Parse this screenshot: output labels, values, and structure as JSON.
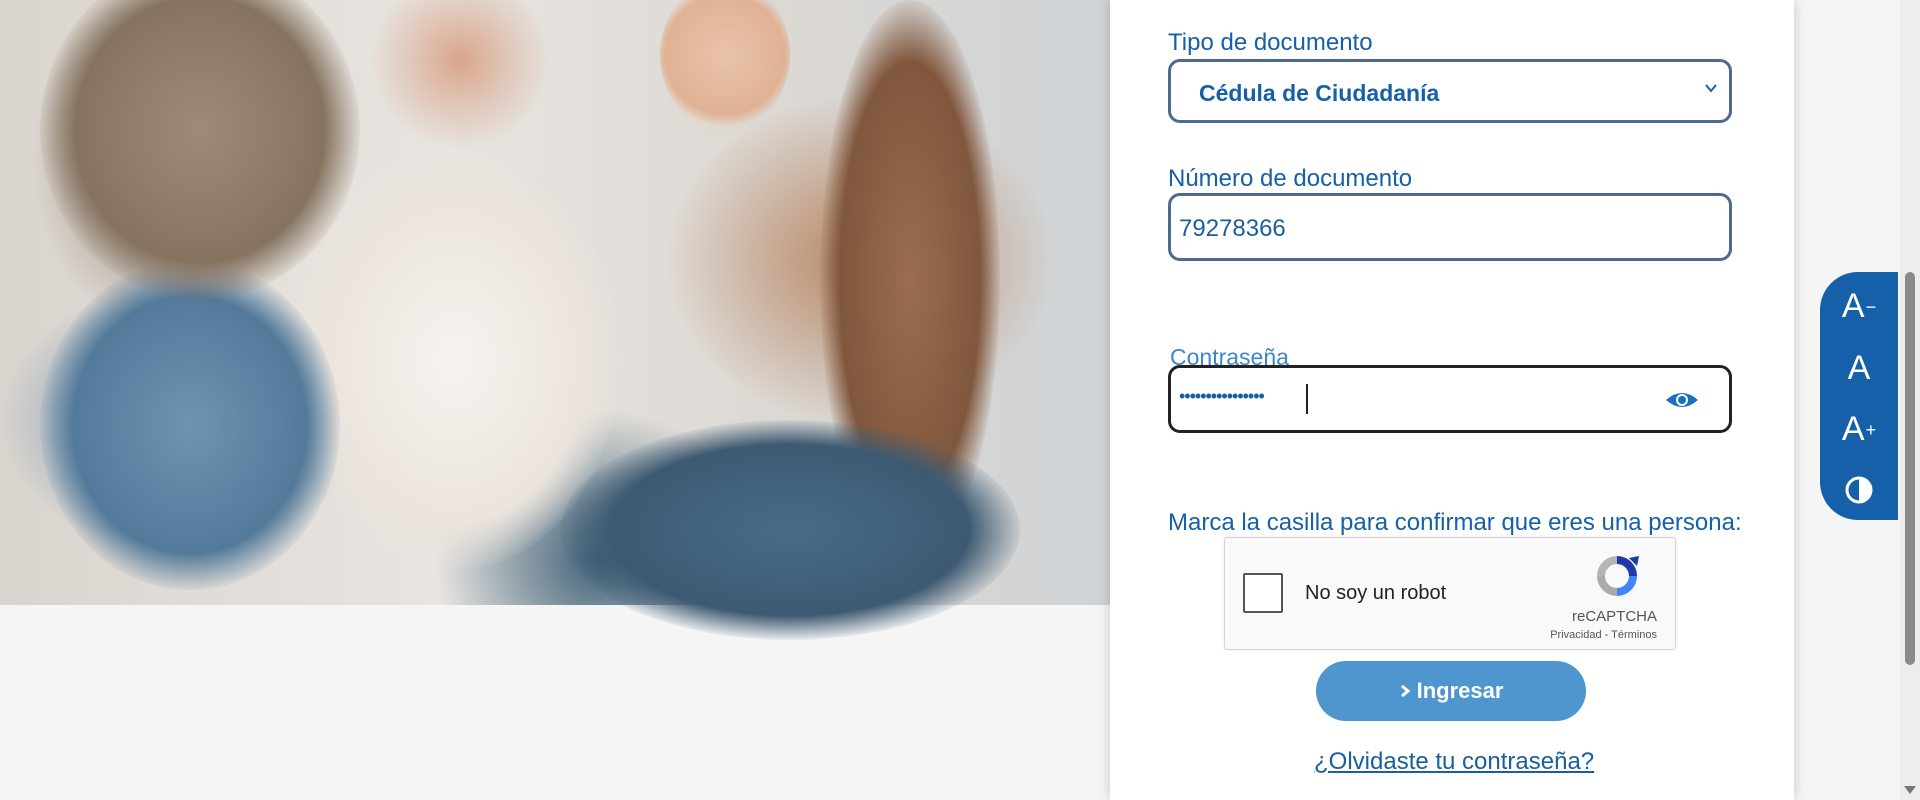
{
  "hero": {
    "image_desc": "family-photo"
  },
  "form": {
    "doc_type_label": "Tipo de documento",
    "doc_type_value": "Cédula de Ciudadanía",
    "doc_number_label": "Número de documento",
    "doc_number_value": "79278366",
    "password_label": "Contraseña",
    "password_value": "••••••••••••••••",
    "captcha_prompt": "Marca la casilla para confirmar que eres una persona:",
    "submit_label": "Ingresar",
    "forgot_link": "¿Olvidaste tu contraseña?"
  },
  "recaptcha": {
    "checkbox_label": "No soy un robot",
    "brand": "reCAPTCHA",
    "privacy": "Privacidad",
    "separator": " - ",
    "terms": "Términos"
  },
  "accessibility": {
    "decrease": "A",
    "decrease_sym": "−",
    "normal": "A",
    "increase": "A",
    "increase_sym": "+"
  },
  "icons": {
    "chevron": "chevron-down-icon",
    "eye": "eye-icon",
    "submit": "chevron-right-icon",
    "contrast": "contrast-icon",
    "recaptcha": "recaptcha-logo-icon"
  },
  "colors": {
    "brand_blue": "#1560a8",
    "button_blue": "#4f96cf",
    "input_border": "#4e6a8e"
  }
}
